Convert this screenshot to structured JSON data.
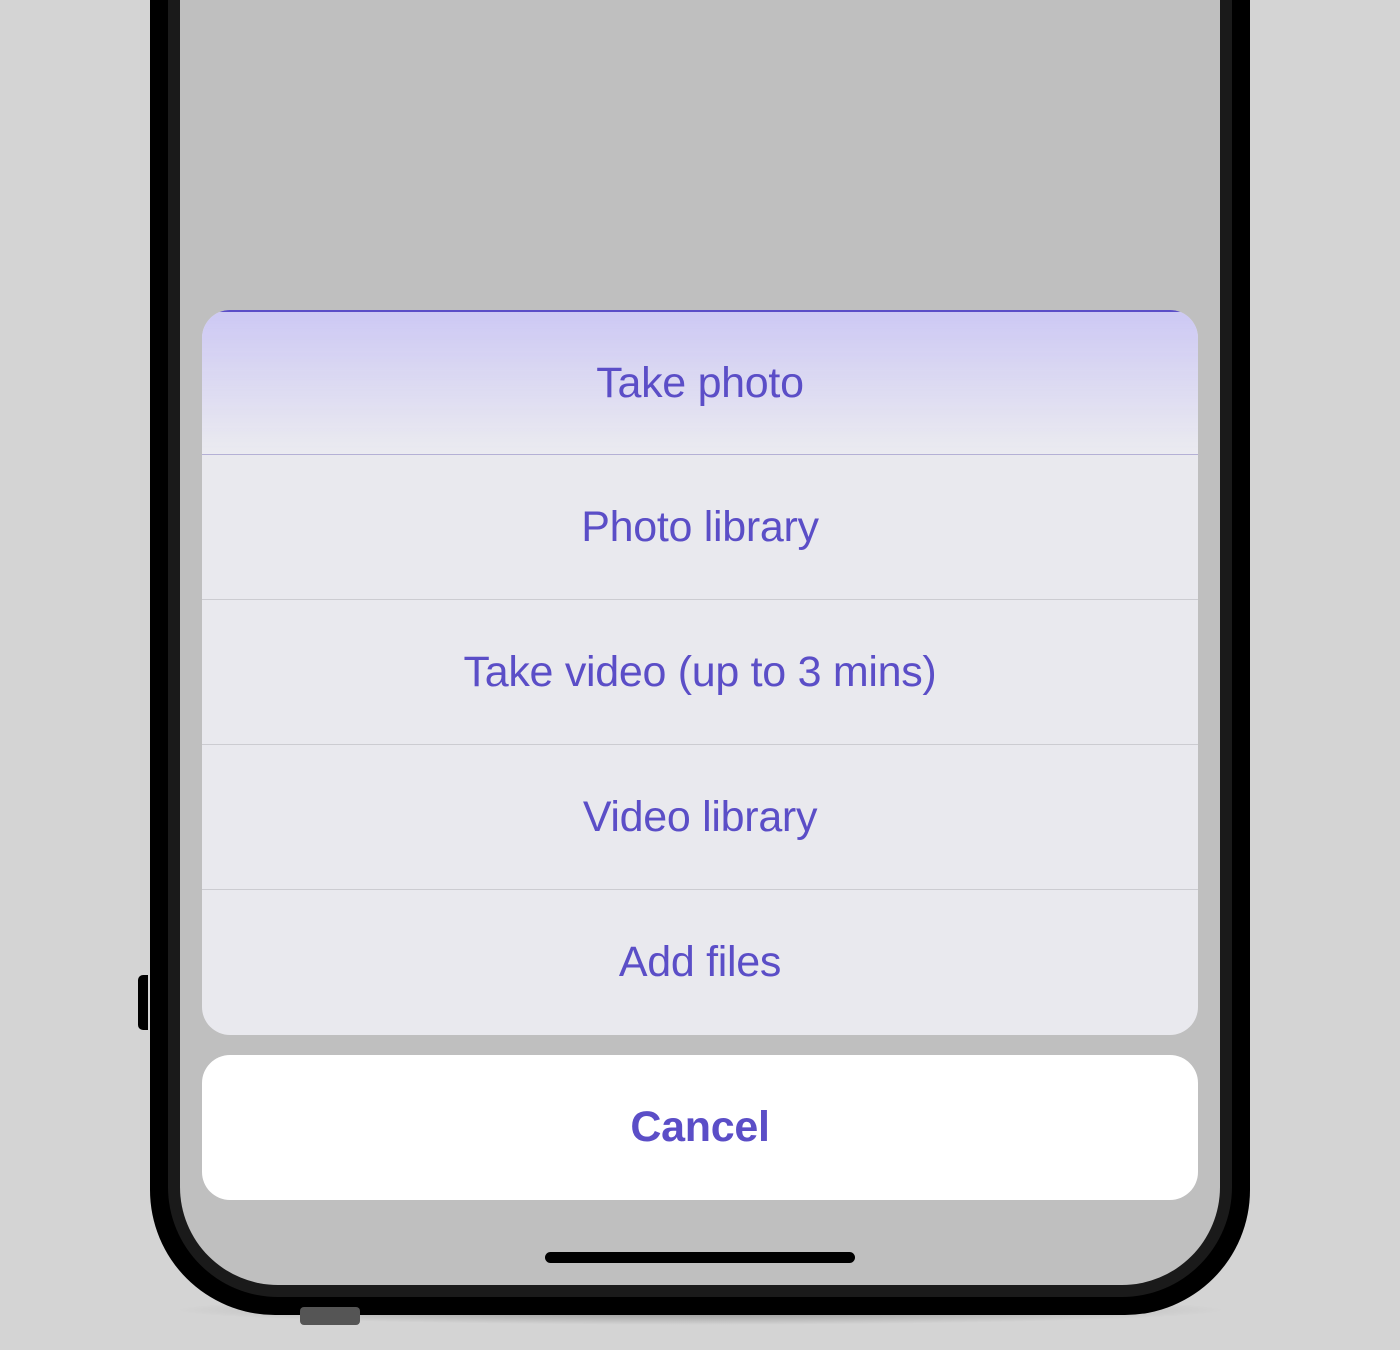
{
  "action_sheet": {
    "options": [
      {
        "label": "Take photo"
      },
      {
        "label": "Photo library"
      },
      {
        "label": "Take video (up to 3 mins)"
      },
      {
        "label": "Video library"
      },
      {
        "label": "Add files"
      }
    ],
    "cancel_label": "Cancel"
  },
  "colors": {
    "tint": "#5b4ec7",
    "sheet_background": "#ededf2",
    "cancel_background": "#ffffff"
  }
}
